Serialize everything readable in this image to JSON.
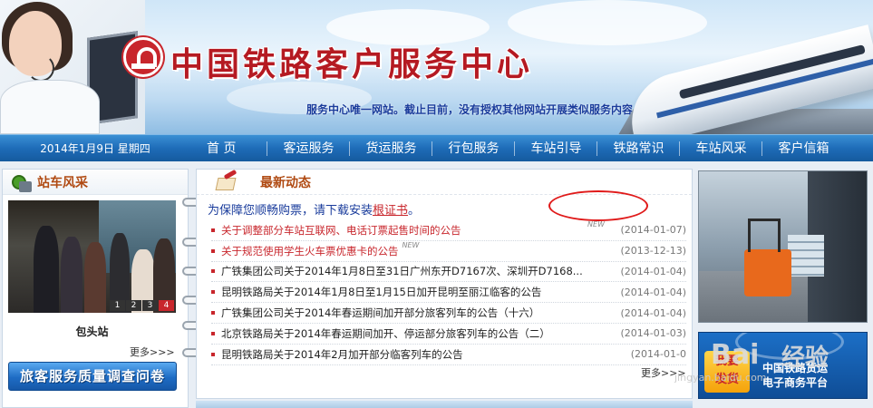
{
  "header": {
    "site_title": "中国铁路客户服务中心",
    "notice": "服务中心唯一网站。截止目前，没有授权其他网站开展类似服务内容，敬请广大用户注意"
  },
  "nav": {
    "date": "2014年1月9日 星期四",
    "items": [
      "首  页",
      "客运服务",
      "货运服务",
      "行包服务",
      "车站引导",
      "铁路常识",
      "车站风采",
      "客户信箱"
    ]
  },
  "left_panel": {
    "title": "站车风采",
    "photo_tabs": [
      "1",
      "2",
      "3",
      "4"
    ],
    "active_tab": "4",
    "caption": "包头站",
    "more": "更多>>>",
    "survey_button": "旅客服务质量调查问卷"
  },
  "news_panel": {
    "title": "最新动态",
    "security_text": "为保障您顺畅购票，请下载安装",
    "security_link": "根证书",
    "security_end": "。",
    "items": [
      {
        "text": "关于调整部分车站互联网、电话订票起售时间的公告",
        "date": "(2014-01-07)",
        "is_new": true,
        "highlight": true
      },
      {
        "text": "关于规范使用学生火车票优惠卡的公告",
        "date": "(2013-12-13)",
        "is_new": true,
        "highlight": true
      },
      {
        "text": "广铁集团公司关于2014年1月8日至31日广州东开D7167次、深圳开D7168...",
        "date": "(2014-01-04)",
        "is_new": false,
        "highlight": false
      },
      {
        "text": "昆明铁路局关于2014年1月8日至1月15日加开昆明至丽江临客的公告",
        "date": "(2014-01-04)",
        "is_new": false,
        "highlight": false
      },
      {
        "text": "广铁集团公司关于2014年春运期间加开部分旅客列车的公告（十六）",
        "date": "(2014-01-04)",
        "is_new": false,
        "highlight": false
      },
      {
        "text": "北京铁路局关于2014年春运期间加开、停运部分旅客列车的公告（二）",
        "date": "(2014-01-03)",
        "is_new": false,
        "highlight": false
      },
      {
        "text": "昆明铁路局关于2014年2月加开部分临客列车的公告",
        "date": "(2014-01-0",
        "is_new": false,
        "highlight": false
      }
    ],
    "new_tag": "NEW",
    "more": "更多>>>"
  },
  "right_panel": {
    "badge": "我要\n发货",
    "line1": "中国铁路货运",
    "line2": "电子商务平台"
  },
  "watermark": {
    "brand": "Bai",
    "jingyan": "经验",
    "url": "jingyan.baidu.com"
  }
}
